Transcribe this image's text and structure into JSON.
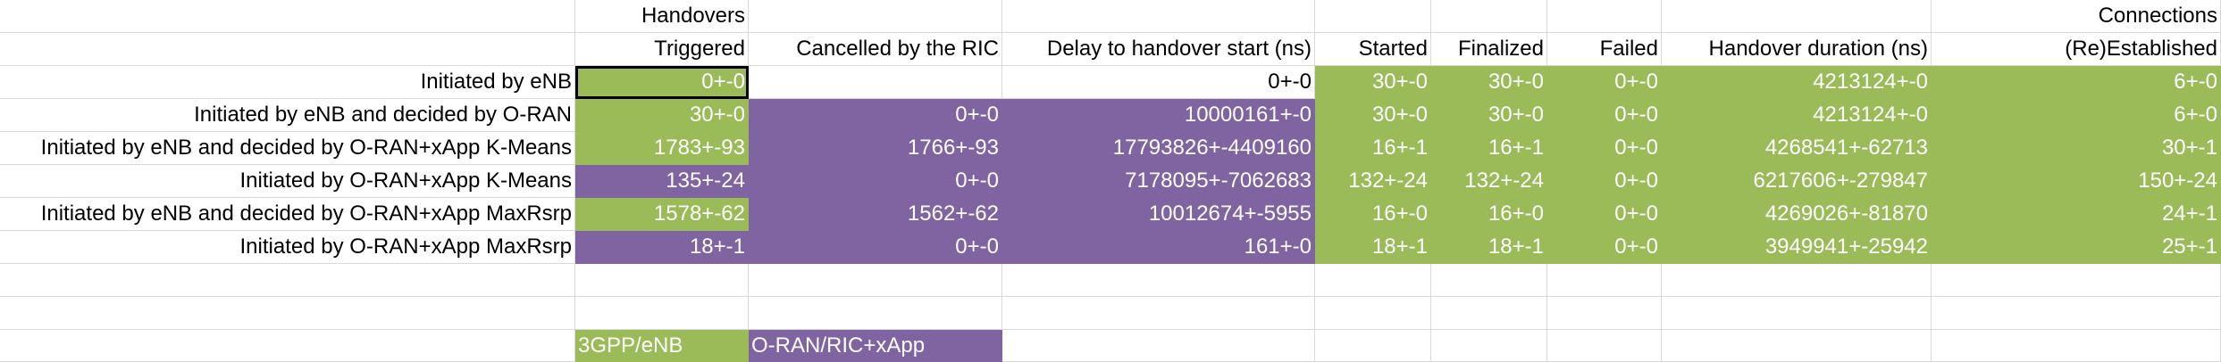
{
  "header": {
    "row1": {
      "handovers": "Handovers",
      "connections": "Connections"
    },
    "row2": {
      "triggered": "Triggered",
      "cancelled": "Cancelled by the RIC",
      "delay": "Delay to handover start (ns)",
      "started": "Started",
      "finalized": "Finalized",
      "failed": "Failed",
      "duration": "Handover duration (ns)",
      "reestablished": "(Re)Established"
    }
  },
  "rows": [
    {
      "label": "Initiated by eNB",
      "triggered": "0+-0",
      "cancelled": "",
      "delay": "0+-0",
      "started": "30+-0",
      "finalized": "30+-0",
      "failed": "0+-0",
      "duration": "4213124+-0",
      "connections": "6+-0"
    },
    {
      "label": "Initiated by eNB and decided by O-RAN",
      "triggered": "30+-0",
      "cancelled": "0+-0",
      "delay": "10000161+-0",
      "started": "30+-0",
      "finalized": "30+-0",
      "failed": "0+-0",
      "duration": "4213124+-0",
      "connections": "6+-0"
    },
    {
      "label": "Initiated by eNB and decided by O-RAN+xApp K-Means",
      "triggered": "1783+-93",
      "cancelled": "1766+-93",
      "delay": "17793826+-4409160",
      "started": "16+-1",
      "finalized": "16+-1",
      "failed": "0+-0",
      "duration": "4268541+-62713",
      "connections": "30+-1"
    },
    {
      "label": "Initiated by O-RAN+xApp K-Means",
      "triggered": "135+-24",
      "cancelled": "0+-0",
      "delay": "7178095+-7062683",
      "started": "132+-24",
      "finalized": "132+-24",
      "failed": "0+-0",
      "duration": "6217606+-279847",
      "connections": "150+-24"
    },
    {
      "label": "Initiated by eNB and decided by O-RAN+xApp MaxRsrp",
      "triggered": "1578+-62",
      "cancelled": "1562+-62",
      "delay": "10012674+-5955",
      "started": "16+-0",
      "finalized": "16+-0",
      "failed": "0+-0",
      "duration": "4269026+-81870",
      "connections": "24+-1"
    },
    {
      "label": "Initiated by O-RAN+xApp MaxRsrp",
      "triggered": "18+-1",
      "cancelled": "0+-0",
      "delay": "161+-0",
      "started": "18+-1",
      "finalized": "18+-1",
      "failed": "0+-0",
      "duration": "3949941+-25942",
      "connections": "25+-1"
    }
  ],
  "legend": {
    "green_label": "3GPP/eNB",
    "purple_label": "O-RAN/RIC+xApp"
  },
  "colors": {
    "green": "#9bbb59",
    "purple": "#8064a2",
    "grid": "#d9d9d9"
  }
}
